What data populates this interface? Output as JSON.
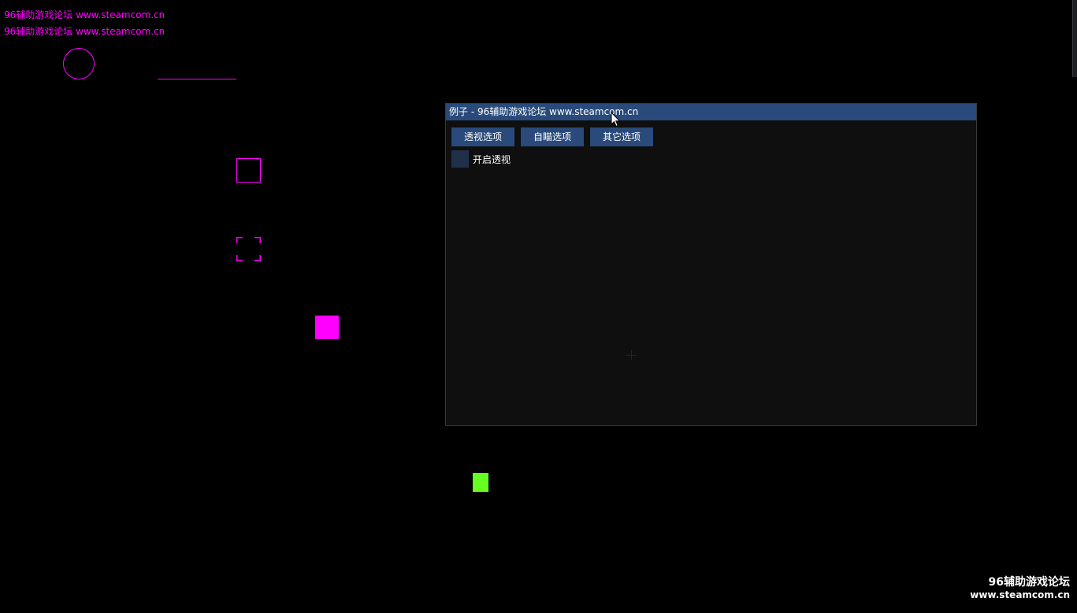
{
  "overlay": {
    "line1": "96辅助游戏论坛 www.steamcom.cn",
    "line2": "96辅助游戏论坛 www.steamcom.cn",
    "color": "#ff00ff"
  },
  "window": {
    "title": "例子 - 96辅助游戏论坛 www.steamcom.cn",
    "tabs": [
      {
        "label": "透视选项"
      },
      {
        "label": "自瞄选项"
      },
      {
        "label": "其它选项"
      }
    ],
    "checkbox": {
      "label": "开启透视",
      "checked": false
    },
    "accent_color": "#294a7a"
  },
  "watermark": {
    "line1": "96辅助游戏论坛",
    "line2": "www.steamcom.cn"
  },
  "icons": {
    "cursor": "mouse-pointer-icon",
    "crosshair": "crosshair-icon"
  },
  "colors": {
    "shape_magenta": "#ff00ff",
    "shape_green": "#66ff22",
    "background": "#000000"
  }
}
